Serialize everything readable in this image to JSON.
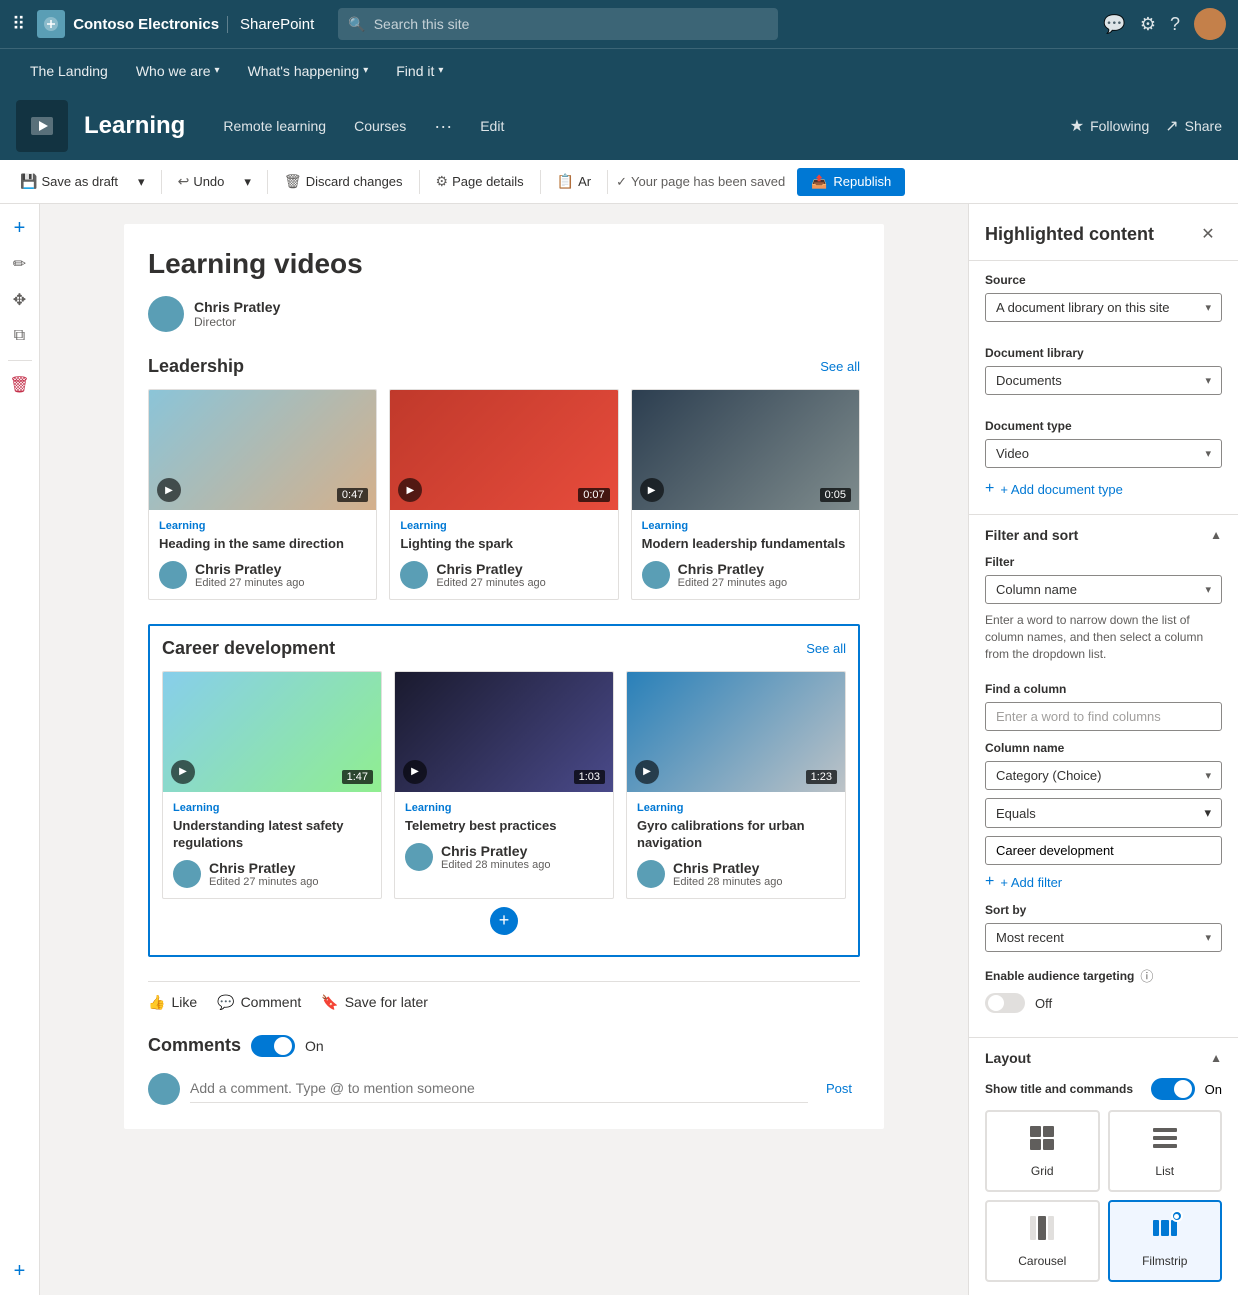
{
  "app": {
    "brand": "Contoso Electronics",
    "app_name": "SharePoint",
    "search_placeholder": "Search this site"
  },
  "site_nav": {
    "items": [
      {
        "label": "The Landing"
      },
      {
        "label": "Who we are",
        "has_dropdown": true
      },
      {
        "label": "What's happening",
        "has_dropdown": true
      },
      {
        "label": "Find it",
        "has_dropdown": true
      }
    ]
  },
  "page_header": {
    "title": "Learning",
    "nav_items": [
      {
        "label": "Remote learning"
      },
      {
        "label": "Courses"
      },
      {
        "label": "..."
      },
      {
        "label": "Edit"
      }
    ],
    "actions": [
      {
        "label": "Following",
        "icon": "★"
      },
      {
        "label": "Share",
        "icon": "↗"
      }
    ]
  },
  "toolbar": {
    "save_draft_label": "Save as draft",
    "undo_label": "Undo",
    "discard_label": "Discard changes",
    "page_details_label": "Page details",
    "ar_label": "Ar",
    "saved_message": "Your page has been saved",
    "republish_label": "Republish"
  },
  "content": {
    "main_title": "Learning videos",
    "author_name": "Chris Pratley",
    "author_title": "Director",
    "sections": [
      {
        "id": "leadership",
        "title": "Leadership",
        "see_all": "See all",
        "videos": [
          {
            "category": "Learning",
            "title": "Heading in the same direction",
            "author": "Chris Pratley",
            "edited": "Edited 27 minutes ago",
            "duration": "0:47",
            "thumb_class": "thumb-1"
          },
          {
            "category": "Learning",
            "title": "Lighting the spark",
            "author": "Chris Pratley",
            "edited": "Edited 27 minutes ago",
            "duration": "0:07",
            "thumb_class": "thumb-2"
          },
          {
            "category": "Learning",
            "title": "Modern leadership fundamentals",
            "author": "Chris Pratley",
            "edited": "Edited 27 minutes ago",
            "duration": "0:05",
            "thumb_class": "thumb-3"
          }
        ]
      },
      {
        "id": "career",
        "title": "Career development",
        "see_all": "See all",
        "videos": [
          {
            "category": "Learning",
            "title": "Understanding latest safety regulations",
            "author": "Chris Pratley",
            "edited": "Edited 27 minutes ago",
            "duration": "1:47",
            "thumb_class": "thumb-4"
          },
          {
            "category": "Learning",
            "title": "Telemetry best practices",
            "author": "Chris Pratley",
            "edited": "Edited 28 minutes ago",
            "duration": "1:03",
            "thumb_class": "thumb-5"
          },
          {
            "category": "Learning",
            "title": "Gyro calibrations for urban navigation",
            "author": "Chris Pratley",
            "edited": "Edited 28 minutes ago",
            "duration": "1:23",
            "thumb_class": "thumb-6"
          }
        ]
      }
    ],
    "reactions": [
      {
        "label": "Like",
        "icon": "👍"
      },
      {
        "label": "Comment",
        "icon": "💬"
      },
      {
        "label": "Save for later",
        "icon": "🔖"
      }
    ],
    "comments": {
      "label": "Comments",
      "toggle_state": "On",
      "input_placeholder": "Add a comment. Type @ to mention someone",
      "post_label": "Post"
    }
  },
  "right_panel": {
    "title": "Highlighted content",
    "source": {
      "label": "Source",
      "value": "A document library on this site"
    },
    "document_library": {
      "label": "Document library",
      "value": "Documents"
    },
    "document_type": {
      "label": "Document type",
      "value": "Video"
    },
    "add_document_type_label": "+ Add document type",
    "filter_sort": {
      "label": "Filter and sort",
      "filter": {
        "label": "Filter",
        "value": "Column name"
      },
      "description": "Enter a word to narrow down the list of column names, and then select a column from the dropdown list.",
      "find_column": {
        "label": "Find a column",
        "placeholder": "Enter a word to find columns"
      },
      "column_name": {
        "label": "Column name",
        "value": "Category (Choice)"
      },
      "equals": {
        "value": "Equals"
      },
      "filter_value": "Career development",
      "add_filter_label": "+ Add filter",
      "sort_by": {
        "label": "Sort by",
        "value": "Most recent"
      },
      "audience_targeting": {
        "label": "Enable audience targeting",
        "state": "Off"
      }
    },
    "layout": {
      "label": "Layout",
      "show_title_commands": "Show title and commands",
      "toggle_state": "On",
      "options": [
        {
          "id": "grid",
          "label": "Grid",
          "icon": "⊞"
        },
        {
          "id": "list",
          "label": "List",
          "icon": "☰"
        },
        {
          "id": "carousel",
          "label": "Carousel",
          "icon": "⊡"
        },
        {
          "id": "filmstrip",
          "label": "Filmstrip",
          "icon": "▤",
          "selected": true
        }
      ]
    }
  }
}
